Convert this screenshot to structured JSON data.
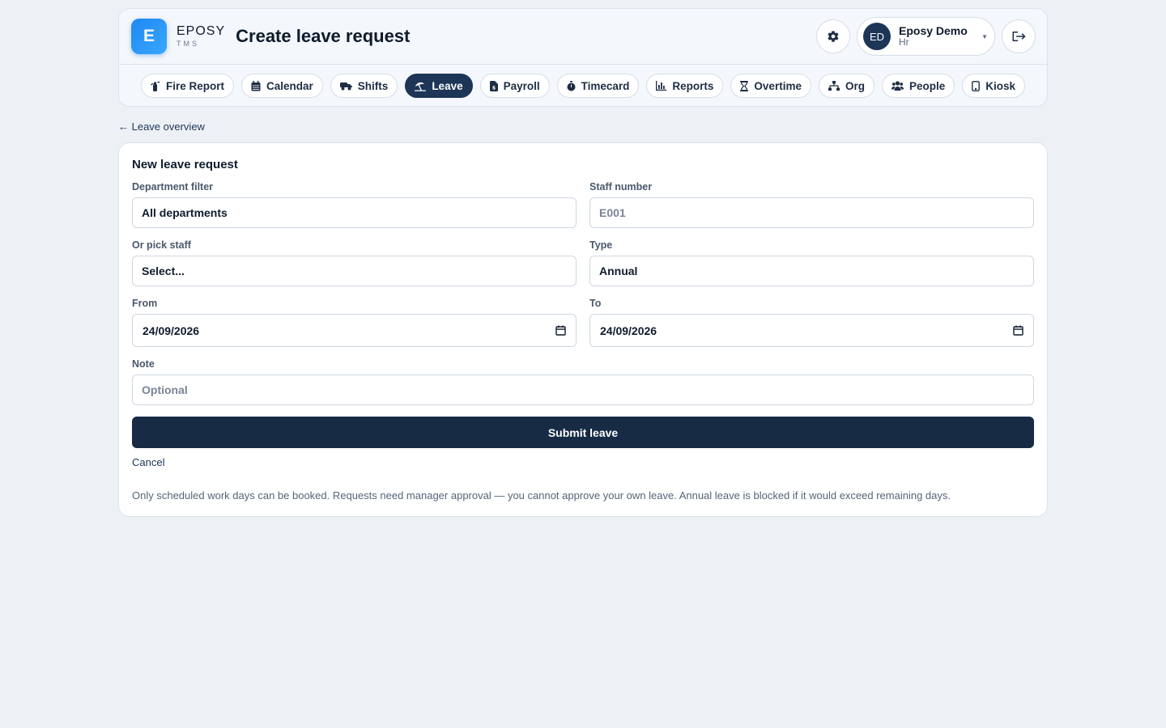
{
  "app": {
    "logo_letter": "E",
    "brand_name": "EPOSY",
    "brand_sub": "TMS",
    "page_title": "Create leave request"
  },
  "user": {
    "initials": "ED",
    "name": "Eposy Demo",
    "role": "Hr"
  },
  "nav": {
    "tabs": [
      {
        "label": "Fire Report",
        "icon": "fire-extinguisher-icon"
      },
      {
        "label": "Calendar",
        "icon": "calendar-icon"
      },
      {
        "label": "Shifts",
        "icon": "truck-icon"
      },
      {
        "label": "Leave",
        "icon": "beach-umbrella-icon",
        "active": true
      },
      {
        "label": "Payroll",
        "icon": "invoice-dollar-icon"
      },
      {
        "label": "Timecard",
        "icon": "stopwatch-icon"
      },
      {
        "label": "Reports",
        "icon": "bar-chart-icon"
      },
      {
        "label": "Overtime",
        "icon": "hourglass-icon"
      },
      {
        "label": "Org",
        "icon": "sitemap-icon"
      },
      {
        "label": "People",
        "icon": "users-icon"
      },
      {
        "label": "Kiosk",
        "icon": "tablet-icon"
      }
    ]
  },
  "back_link": "← Leave overview",
  "form": {
    "title": "New leave request",
    "department_filter": {
      "label": "Department filter",
      "value": "All departments"
    },
    "staff_number": {
      "label": "Staff number",
      "placeholder": "E001"
    },
    "pick_staff": {
      "label": "Or pick staff",
      "value": "Select..."
    },
    "type": {
      "label": "Type",
      "value": "Annual"
    },
    "from": {
      "label": "From",
      "value": "24/09/2026"
    },
    "to": {
      "label": "To",
      "value": "24/09/2026"
    },
    "note": {
      "label": "Note",
      "placeholder": "Optional"
    },
    "submit_label": "Submit leave",
    "cancel_label": "Cancel",
    "help": "Only scheduled work days can be booked. Requests need manager approval — you cannot approve your own leave. Annual leave is blocked if it would exceed remaining days."
  },
  "colors": {
    "background": "#edf1f6",
    "primary": "#1d3557",
    "submit": "#172b45",
    "logo_gradient_start": "#1e88f0",
    "logo_gradient_end": "#3aa7ff"
  }
}
